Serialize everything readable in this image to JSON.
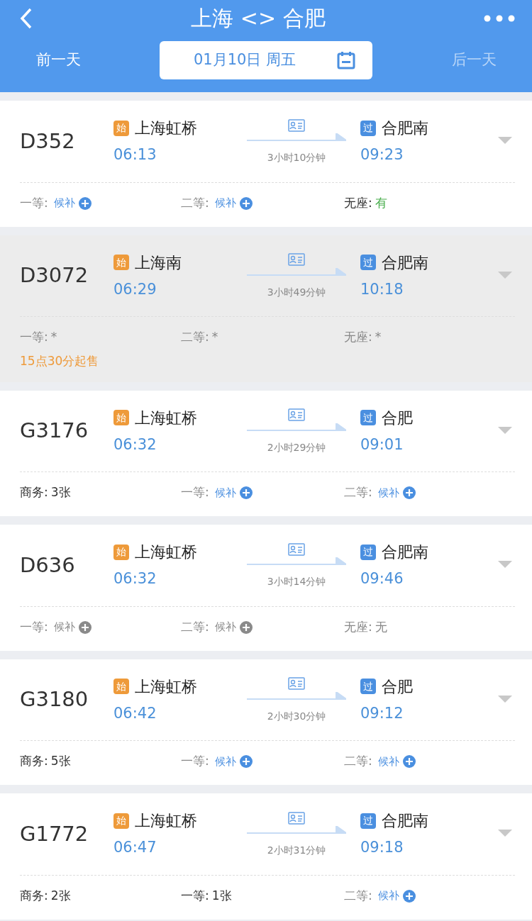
{
  "header": {
    "title": "上海 <> 合肥",
    "prev_day": {
      "label": "前一天",
      "disabled": false
    },
    "date": "01月10日 周五",
    "next_day": {
      "label": "后一天",
      "disabled": true
    }
  },
  "trains": [
    {
      "code": "D352",
      "on_sale": true,
      "from_badge": "始",
      "from": "上海虹桥",
      "depart": "06:13",
      "duration": "3小时10分钟",
      "to_badge": "过",
      "to": "合肥南",
      "arrive": "09:23",
      "seats": [
        {
          "label": "一等:",
          "value": "候补",
          "kind": "waitlist",
          "available": true
        },
        {
          "label": "二等:",
          "value": "候补",
          "kind": "waitlist",
          "available": true
        },
        {
          "label": "无座:",
          "value": "有",
          "kind": "plenty"
        }
      ]
    },
    {
      "code": "D3072",
      "on_sale": false,
      "from_badge": "始",
      "from": "上海南",
      "depart": "06:29",
      "duration": "3小时49分钟",
      "to_badge": "过",
      "to": "合肥南",
      "arrive": "10:18",
      "seats": [
        {
          "label": "一等:",
          "value": "*",
          "kind": "hidden"
        },
        {
          "label": "二等:",
          "value": "*",
          "kind": "hidden"
        },
        {
          "label": "无座:",
          "value": "*",
          "kind": "hidden"
        }
      ],
      "note": "15点30分起售"
    },
    {
      "code": "G3176",
      "on_sale": true,
      "from_badge": "始",
      "from": "上海虹桥",
      "depart": "06:32",
      "duration": "2小时29分钟",
      "to_badge": "过",
      "to": "合肥",
      "arrive": "09:01",
      "seats": [
        {
          "label": "商务:",
          "value": "3张",
          "kind": "count"
        },
        {
          "label": "一等:",
          "value": "候补",
          "kind": "waitlist",
          "available": true
        },
        {
          "label": "二等:",
          "value": "候补",
          "kind": "waitlist",
          "available": true
        }
      ]
    },
    {
      "code": "D636",
      "on_sale": true,
      "from_badge": "始",
      "from": "上海虹桥",
      "depart": "06:32",
      "duration": "3小时14分钟",
      "to_badge": "过",
      "to": "合肥南",
      "arrive": "09:46",
      "seats": [
        {
          "label": "一等:",
          "value": "候补",
          "kind": "waitlist",
          "available": false
        },
        {
          "label": "二等:",
          "value": "候补",
          "kind": "waitlist",
          "available": false
        },
        {
          "label": "无座:",
          "value": "无",
          "kind": "none"
        }
      ]
    },
    {
      "code": "G3180",
      "on_sale": true,
      "from_badge": "始",
      "from": "上海虹桥",
      "depart": "06:42",
      "duration": "2小时30分钟",
      "to_badge": "过",
      "to": "合肥",
      "arrive": "09:12",
      "seats": [
        {
          "label": "商务:",
          "value": "5张",
          "kind": "count"
        },
        {
          "label": "一等:",
          "value": "候补",
          "kind": "waitlist",
          "available": true
        },
        {
          "label": "二等:",
          "value": "候补",
          "kind": "waitlist",
          "available": true
        }
      ]
    },
    {
      "code": "G1772",
      "on_sale": true,
      "from_badge": "始",
      "from": "上海虹桥",
      "depart": "06:47",
      "duration": "2小时31分钟",
      "to_badge": "过",
      "to": "合肥南",
      "arrive": "09:18",
      "seats": [
        {
          "label": "商务:",
          "value": "2张",
          "kind": "count"
        },
        {
          "label": "一等:",
          "value": "1张",
          "kind": "count"
        },
        {
          "label": "二等:",
          "value": "候补",
          "kind": "waitlist",
          "available": true
        }
      ]
    }
  ]
}
